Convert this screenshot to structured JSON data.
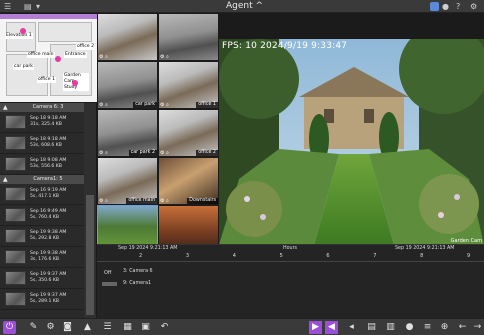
{
  "app": {
    "title": "Agent",
    "title_caret": "^"
  },
  "topbar_icons": [
    "menu-icon",
    "server-icon",
    "dropdown-icon",
    "notifications-icon",
    "user-icon",
    "help-icon",
    "settings-icon"
  ],
  "colors": {
    "accent": "#9b4fd6",
    "floorplan_header": "#b27ed8",
    "camera_marker": "#e83aa0"
  },
  "floorplan": {
    "rooms": [
      "Elevation 1",
      "office main",
      "car park",
      "Entrance",
      "office 2",
      "office 1",
      "Garden Cam Study"
    ]
  },
  "groups": [
    {
      "name": "Camera 6: 3",
      "records": [
        {
          "line1": "Sep 18 9:18 AM",
          "line2": "31s, 325.4 KB"
        },
        {
          "line1": "Sep 18 9:18 AM",
          "line2": "53s, 608.6 KB"
        },
        {
          "line1": "Sep 18 9:08 AM",
          "line2": "53s, 556.6 KB"
        }
      ]
    },
    {
      "name": "Camera1: 5",
      "records": [
        {
          "line1": "Sep 16 9:19 AM",
          "line2": "5s, 417.1 KB"
        },
        {
          "line1": "Sep 16 9:49 AM",
          "line2": "5s, 760.4 KB"
        },
        {
          "line1": "Sep 19 9:38 AM",
          "line2": "5s, 292.8 KB"
        },
        {
          "line1": "Sep 19 9:38 AM",
          "line2": "3s, 176.6 KB"
        },
        {
          "line1": "Sep 19 9:37 AM",
          "line2": "5s, 350.6 KB"
        },
        {
          "line1": "Sep 19 9:37 AM",
          "line2": "5s, 289.1 KB"
        }
      ]
    }
  ],
  "cameras": [
    {
      "label": "",
      "scene": "office"
    },
    {
      "label": "",
      "scene": "carpark"
    },
    {
      "label": "car park",
      "scene": "carpark"
    },
    {
      "label": "office 1",
      "scene": "office"
    },
    {
      "label": "car park 2",
      "scene": "carpark"
    },
    {
      "label": "office 2",
      "scene": "office"
    },
    {
      "label": "office main",
      "scene": "office"
    },
    {
      "label": "Downstairs",
      "scene": "stairs"
    },
    {
      "label": "Garden Cam",
      "scene": "garden"
    },
    {
      "label": "Entrance",
      "scene": "lobby"
    },
    {
      "label": "Study",
      "scene": "office"
    },
    {
      "label": "Elevation 1",
      "scene": "house"
    }
  ],
  "main_view": {
    "overlay": "FPS: 10 2024/9/19 9:33:47",
    "camera_label": "Garden Cam"
  },
  "timeline": {
    "date_label": "Sep 19 2024 9:21:13 AM",
    "center_label": "Hours",
    "right_label": "Sep 19 2024 9:21:13 AM",
    "ticks": [
      "2",
      "3",
      "4",
      "5",
      "6",
      "7",
      "8",
      "9"
    ],
    "off_label": "Off",
    "rows": [
      "3: Camera 6",
      "9: Camera1"
    ]
  },
  "bottombar_icons": [
    "power-icon",
    "edit-icon",
    "settings-icon",
    "camera-icon",
    "alert-icon",
    "list-icon",
    "grid-icon",
    "image-icon",
    "undo-icon",
    "play-icon",
    "volume-icon",
    "volume-low-icon",
    "layout-icon",
    "keyboard-icon",
    "mic-icon",
    "menu-icon",
    "target-icon",
    "tools-icon",
    "back-icon",
    "forward-icon"
  ]
}
